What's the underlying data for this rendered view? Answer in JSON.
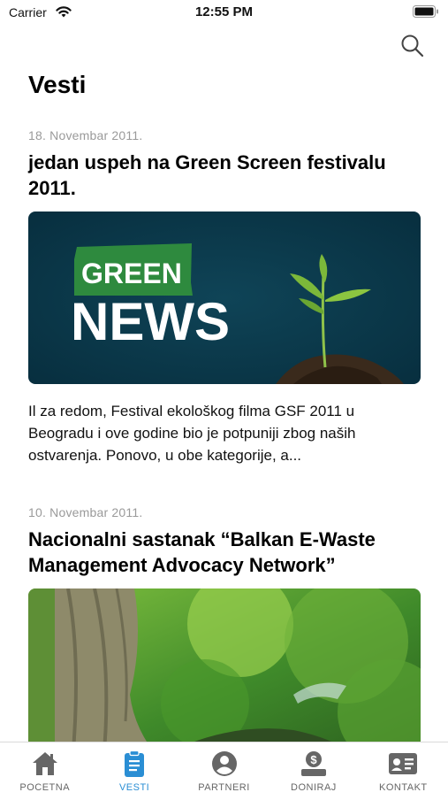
{
  "status": {
    "carrier": "Carrier",
    "time": "12:55 PM"
  },
  "header": {
    "title": "Vesti",
    "search_icon": "search-icon"
  },
  "articles": [
    {
      "date": "18. Novembar 2011.",
      "title": "jedan uspeh na Green Screen festivalu 2011.",
      "image_text": {
        "line1": "GREEN",
        "line2": "NEWS"
      },
      "excerpt": "Il za redom, Festival ekološkog filma GSF 2011 u Beogradu i ove godine bio je potpuniji zbog naših ostvarenja. Ponovo, u obe kategorije, a..."
    },
    {
      "date": "10. Novembar 2011.",
      "title": "Nacionalni sastanak “Balkan E-Waste Management Advocacy Network”"
    }
  ],
  "tabbar": {
    "active_color": "#2a8ed4",
    "inactive_color": "#666666",
    "items": [
      {
        "label": "POCETNA",
        "icon": "home-icon"
      },
      {
        "label": "VESTI",
        "icon": "clipboard-icon"
      },
      {
        "label": "PARTNERI",
        "icon": "user-circle-icon"
      },
      {
        "label": "DONIRAJ",
        "icon": "donate-icon"
      },
      {
        "label": "KONTAKT",
        "icon": "contact-card-icon"
      }
    ]
  }
}
